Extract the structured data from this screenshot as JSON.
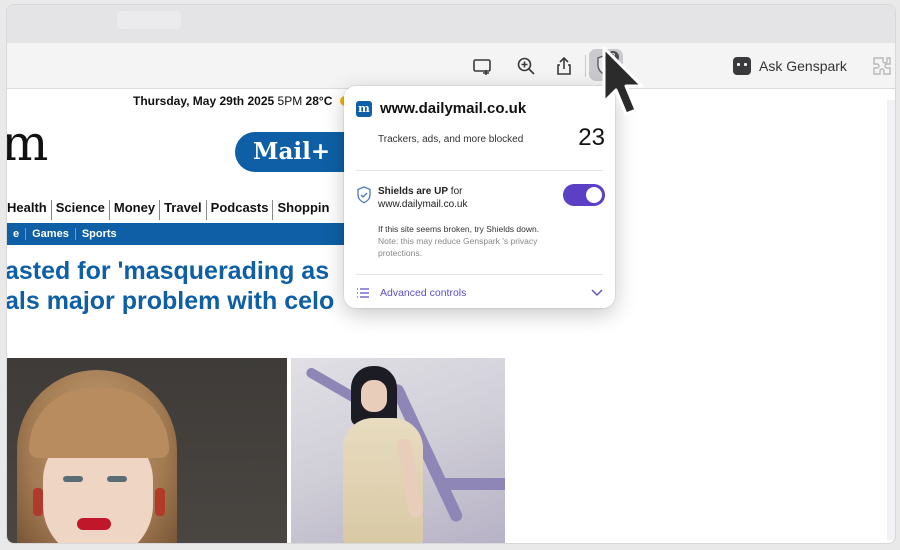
{
  "toolbar": {
    "shield_badge": "3",
    "ask_label": "Ask Genspark"
  },
  "page": {
    "date_bold": "Thursday, May 29th 2025",
    "date_light": "5PM",
    "temp": "28°C",
    "logo_fragment": "m",
    "mailplus_label": "Mail+",
    "nav_items": [
      "Health",
      "Science",
      "Money",
      "Travel",
      "Podcasts",
      "Shoppin"
    ],
    "nav_prefix": "",
    "subnav_items": [
      "e",
      "Games",
      "Sports"
    ],
    "headline_line1": "asted for 'masquerading as",
    "headline_line2": "als major problem with celo"
  },
  "popup": {
    "site_favicon": "m",
    "site": "www.dailymail.co.uk",
    "blocked_label": "Trackers, ads, and more blocked",
    "blocked_count": "23",
    "shields_bold": "Shields are UP",
    "shields_for": " for",
    "shields_site": "www.dailymail.co.uk",
    "shields_on": true,
    "note_line1": "If this site seems broken, try Shields down.",
    "note_line2": "Note: this may reduce Genspark 's privacy protections.",
    "advanced_label": "Advanced controls"
  },
  "colors": {
    "brand_blue": "#0e5fa6",
    "toggle_purple": "#5b3fc4",
    "link_purple": "#5b4fc4"
  },
  "icons": [
    "cast-icon",
    "zoom-icon",
    "share-icon",
    "shield-icon",
    "genspark-icon",
    "extension-icon",
    "list-icon",
    "chevron-down-icon",
    "cursor-icon"
  ]
}
